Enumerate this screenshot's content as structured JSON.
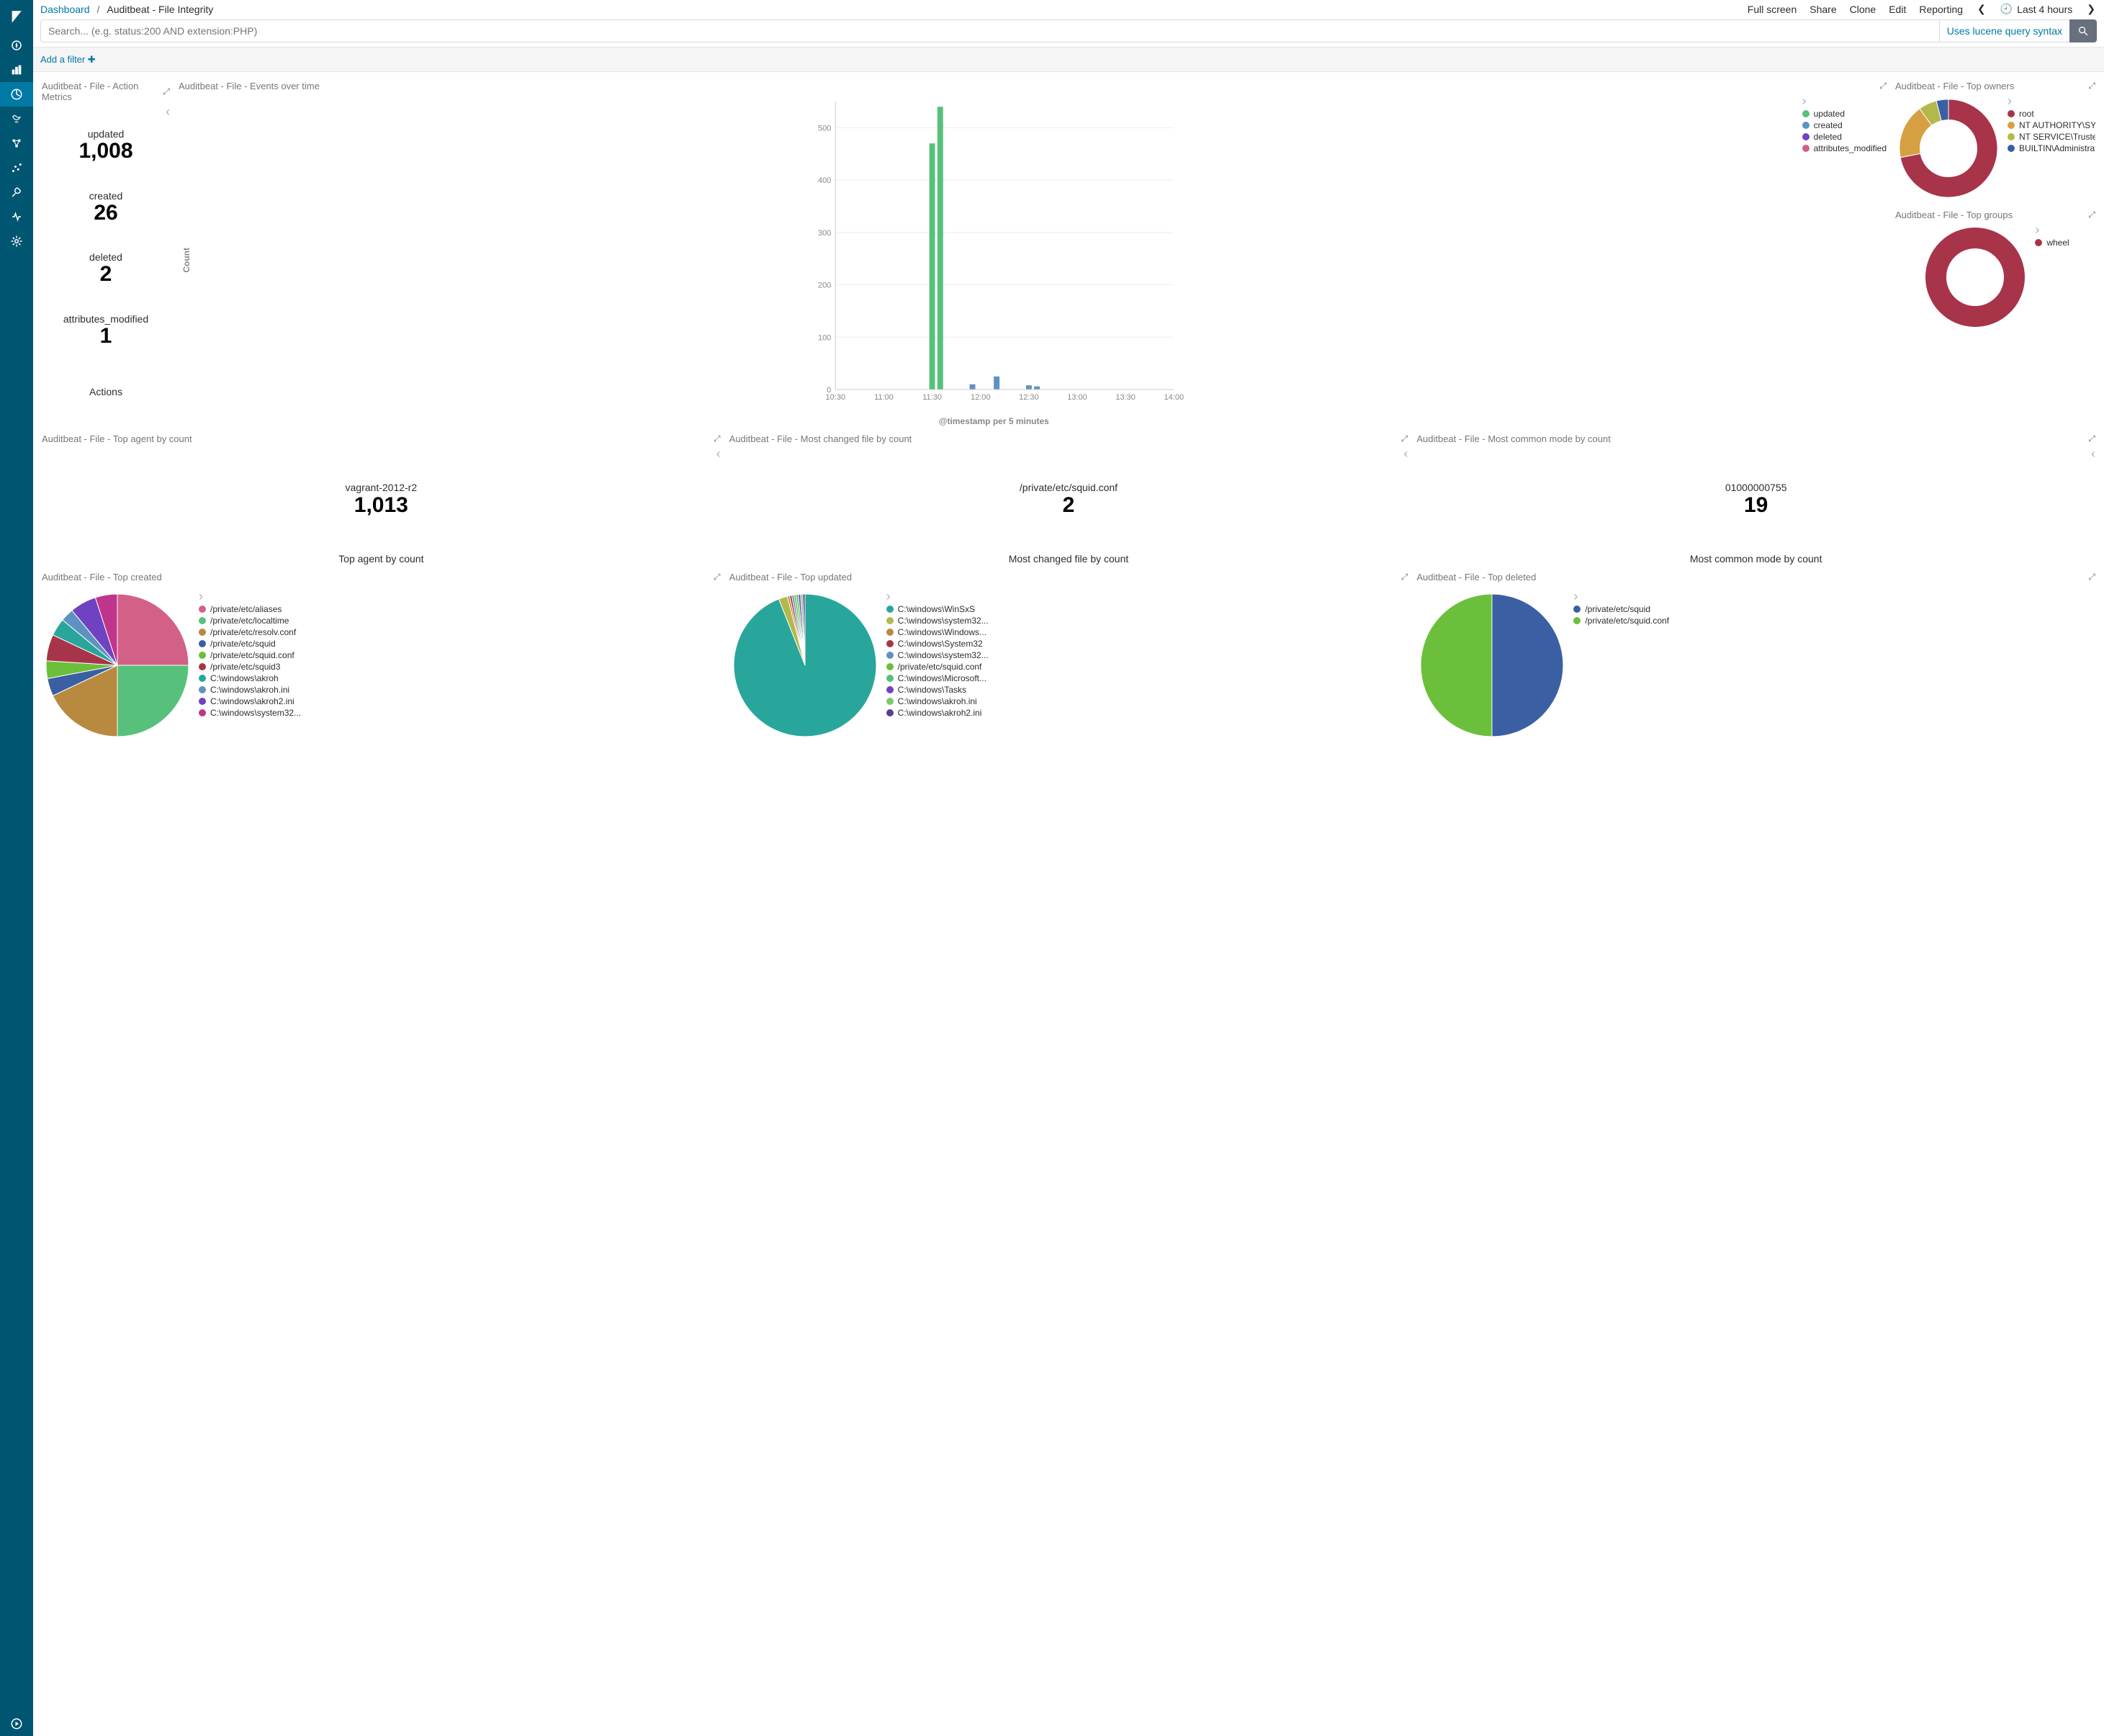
{
  "header": {
    "breadcrumb_root": "Dashboard",
    "breadcrumb_current": "Auditbeat - File Integrity",
    "actions": {
      "fullscreen": "Full screen",
      "share": "Share",
      "clone": "Clone",
      "edit": "Edit",
      "reporting": "Reporting",
      "time_range": "Last 4 hours"
    },
    "search_placeholder": "Search... (e.g. status:200 AND extension:PHP)",
    "lucene_hint": "Uses lucene query syntax",
    "add_filter": "Add a filter"
  },
  "panels": {
    "action_metrics": {
      "title": "Auditbeat - File - Action Metrics",
      "metrics": [
        {
          "label": "updated",
          "value": "1,008"
        },
        {
          "label": "created",
          "value": "26"
        },
        {
          "label": "deleted",
          "value": "2"
        },
        {
          "label": "attributes_modified",
          "value": "1"
        }
      ],
      "footer": "Actions"
    },
    "events_over_time": {
      "title": "Auditbeat - File - Events over time",
      "legend": [
        {
          "label": "updated",
          "color": "#57c17b"
        },
        {
          "label": "created",
          "color": "#6092c0"
        },
        {
          "label": "deleted",
          "color": "#6f42c1"
        },
        {
          "label": "attributes_modified",
          "color": "#d36086"
        }
      ]
    },
    "top_owners": {
      "title": "Auditbeat - File - Top owners",
      "legend": [
        {
          "label": "root",
          "color": "#a8344a"
        },
        {
          "label": "NT AUTHORITY\\SYSTE...",
          "color": "#d6a042"
        },
        {
          "label": "NT SERVICE\\TrustedIn...",
          "color": "#b3b84a"
        },
        {
          "label": "BUILTIN\\Administrato...",
          "color": "#3b5fa3"
        }
      ]
    },
    "top_groups": {
      "title": "Auditbeat - File - Top groups",
      "legend": [
        {
          "label": "wheel",
          "color": "#a8344a"
        }
      ]
    },
    "top_agent": {
      "title": "Auditbeat - File - Top agent by count",
      "label": "vagrant-2012-r2",
      "value": "1,013",
      "footer": "Top agent by count"
    },
    "most_changed_file": {
      "title": "Auditbeat - File - Most changed file by count",
      "label": "/private/etc/squid.conf",
      "value": "2",
      "footer": "Most changed file by count"
    },
    "most_common_mode": {
      "title": "Auditbeat - File - Most common mode by count",
      "label": "01000000755",
      "value": "19",
      "footer": "Most common mode by count"
    },
    "top_created": {
      "title": "Auditbeat - File - Top created",
      "legend": [
        {
          "label": "/private/etc/aliases",
          "color": "#d36086"
        },
        {
          "label": "/private/etc/localtime",
          "color": "#57c17b"
        },
        {
          "label": "/private/etc/resolv.conf",
          "color": "#b88a3f"
        },
        {
          "label": "/private/etc/squid",
          "color": "#3b5fa3"
        },
        {
          "label": "/private/etc/squid.conf",
          "color": "#6bbf3b"
        },
        {
          "label": "/private/etc/squid3",
          "color": "#a8344a"
        },
        {
          "label": "C:\\windows\\akroh",
          "color": "#29a69c"
        },
        {
          "label": "C:\\windows\\akroh.ini",
          "color": "#6092c0"
        },
        {
          "label": "C:\\windows\\akroh2.ini",
          "color": "#6f42c1"
        },
        {
          "label": "C:\\windows\\system32...",
          "color": "#c1348b"
        }
      ]
    },
    "top_updated": {
      "title": "Auditbeat - File - Top updated",
      "legend": [
        {
          "label": "C:\\windows\\WinSxS",
          "color": "#29a69c"
        },
        {
          "label": "C:\\windows\\system32...",
          "color": "#b3b84a"
        },
        {
          "label": "C:\\windows\\Windows...",
          "color": "#b88a3f"
        },
        {
          "label": "C:\\windows\\System32",
          "color": "#a8344a"
        },
        {
          "label": "C:\\windows\\system32...",
          "color": "#6092c0"
        },
        {
          "label": "/private/etc/squid.conf",
          "color": "#6bbf3b"
        },
        {
          "label": "C:\\windows\\Microsoft...",
          "color": "#57c17b"
        },
        {
          "label": "C:\\windows\\Tasks",
          "color": "#6f42c1"
        },
        {
          "label": "C:\\windows\\akroh.ini",
          "color": "#7bc96f"
        },
        {
          "label": "C:\\windows\\akroh2.ini",
          "color": "#5c3c8e"
        }
      ]
    },
    "top_deleted": {
      "title": "Auditbeat - File - Top deleted",
      "legend": [
        {
          "label": "/private/etc/squid",
          "color": "#3b5fa3"
        },
        {
          "label": "/private/etc/squid.conf",
          "color": "#6bbf3b"
        }
      ]
    }
  },
  "chart_data": [
    {
      "id": "events_over_time",
      "type": "bar",
      "title": "Auditbeat - File - Events over time",
      "xlabel": "@timestamp per 5 minutes",
      "ylabel": "Count",
      "ylim": [
        0,
        550
      ],
      "x_ticks": [
        "10:30",
        "11:00",
        "11:30",
        "12:00",
        "12:30",
        "13:00",
        "13:30",
        "14:00"
      ],
      "series": [
        {
          "name": "updated",
          "color": "#57c17b",
          "points": [
            {
              "x": "11:30",
              "y": 470
            },
            {
              "x": "11:35",
              "y": 540
            }
          ]
        },
        {
          "name": "created",
          "color": "#6092c0",
          "points": [
            {
              "x": "11:55",
              "y": 10
            },
            {
              "x": "12:10",
              "y": 25
            },
            {
              "x": "12:30",
              "y": 8
            },
            {
              "x": "12:35",
              "y": 6
            }
          ]
        },
        {
          "name": "deleted",
          "color": "#6f42c1",
          "points": []
        },
        {
          "name": "attributes_modified",
          "color": "#d36086",
          "points": []
        }
      ]
    },
    {
      "id": "top_owners",
      "type": "pie",
      "donut": true,
      "title": "Auditbeat - File - Top owners",
      "series": [
        {
          "name": "root",
          "value": 72,
          "color": "#a8344a"
        },
        {
          "name": "NT AUTHORITY\\SYSTEM",
          "value": 18,
          "color": "#d6a042"
        },
        {
          "name": "NT SERVICE\\TrustedInstaller",
          "value": 6,
          "color": "#b3b84a"
        },
        {
          "name": "BUILTIN\\Administrators",
          "value": 4,
          "color": "#3b5fa3"
        }
      ]
    },
    {
      "id": "top_groups",
      "type": "pie",
      "donut": true,
      "title": "Auditbeat - File - Top groups",
      "series": [
        {
          "name": "wheel",
          "value": 100,
          "color": "#a8344a"
        }
      ]
    },
    {
      "id": "top_created",
      "type": "pie",
      "donut": false,
      "title": "Auditbeat - File - Top created",
      "series": [
        {
          "name": "/private/etc/aliases",
          "value": 25,
          "color": "#d36086"
        },
        {
          "name": "/private/etc/localtime",
          "value": 25,
          "color": "#57c17b"
        },
        {
          "name": "/private/etc/resolv.conf",
          "value": 18,
          "color": "#b88a3f"
        },
        {
          "name": "/private/etc/squid",
          "value": 4,
          "color": "#3b5fa3"
        },
        {
          "name": "/private/etc/squid.conf",
          "value": 4,
          "color": "#6bbf3b"
        },
        {
          "name": "/private/etc/squid3",
          "value": 6,
          "color": "#a8344a"
        },
        {
          "name": "C:\\windows\\akroh",
          "value": 4,
          "color": "#29a69c"
        },
        {
          "name": "C:\\windows\\akroh.ini",
          "value": 3,
          "color": "#6092c0"
        },
        {
          "name": "C:\\windows\\akroh2.ini",
          "value": 6,
          "color": "#6f42c1"
        },
        {
          "name": "C:\\windows\\system32...",
          "value": 5,
          "color": "#c1348b"
        }
      ]
    },
    {
      "id": "top_updated",
      "type": "pie",
      "donut": false,
      "title": "Auditbeat - File - Top updated",
      "series": [
        {
          "name": "C:\\windows\\WinSxS",
          "value": 94,
          "color": "#29a69c"
        },
        {
          "name": "C:\\windows\\system32...",
          "value": 2,
          "color": "#b3b84a"
        },
        {
          "name": "C:\\windows\\Windows...",
          "value": 0.5,
          "color": "#b88a3f"
        },
        {
          "name": "C:\\windows\\System32",
          "value": 0.5,
          "color": "#a8344a"
        },
        {
          "name": "C:\\windows\\system32...",
          "value": 0.5,
          "color": "#6092c0"
        },
        {
          "name": "/private/etc/squid.conf",
          "value": 0.5,
          "color": "#6bbf3b"
        },
        {
          "name": "C:\\windows\\Microsoft...",
          "value": 0.5,
          "color": "#57c17b"
        },
        {
          "name": "C:\\windows\\Tasks",
          "value": 0.5,
          "color": "#6f42c1"
        },
        {
          "name": "C:\\windows\\akroh.ini",
          "value": 0.5,
          "color": "#7bc96f"
        },
        {
          "name": "C:\\windows\\akroh2.ini",
          "value": 0.5,
          "color": "#5c3c8e"
        }
      ]
    },
    {
      "id": "top_deleted",
      "type": "pie",
      "donut": false,
      "title": "Auditbeat - File - Top deleted",
      "series": [
        {
          "name": "/private/etc/squid",
          "value": 50,
          "color": "#3b5fa3"
        },
        {
          "name": "/private/etc/squid.conf",
          "value": 50,
          "color": "#6bbf3b"
        }
      ]
    }
  ]
}
